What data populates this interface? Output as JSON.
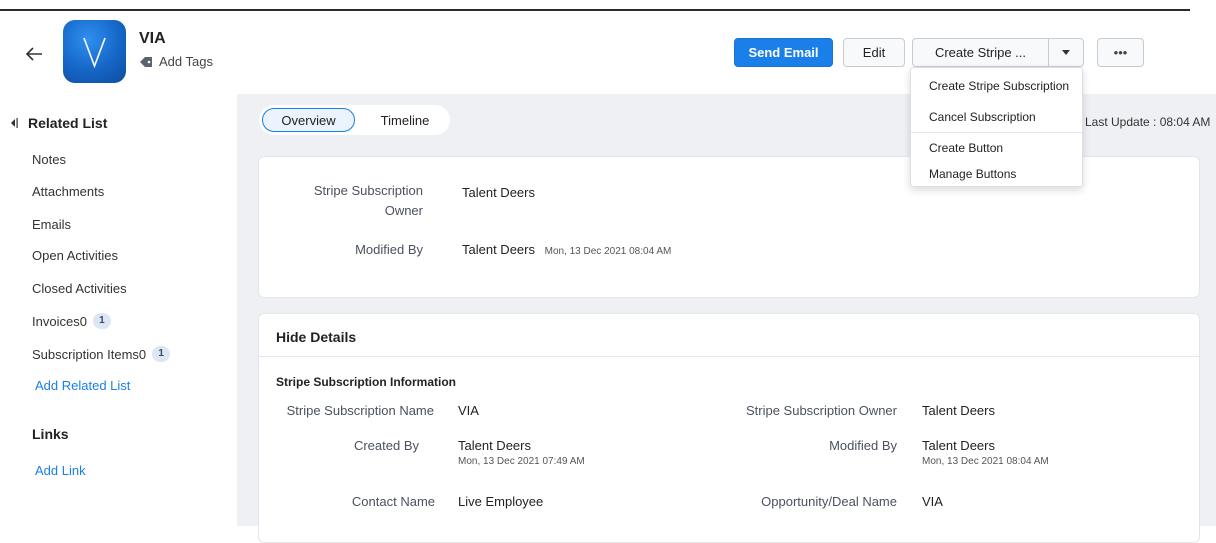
{
  "header": {
    "record_name": "VIA",
    "add_tags_label": "Add Tags",
    "send_email_label": "Send Email",
    "edit_label": "Edit",
    "create_stripe_label": "Create Stripe ...",
    "more_label": "•••"
  },
  "dropdown": {
    "items": [
      "Create Stripe Subscription",
      "Cancel Subscription",
      "Create Button",
      "Manage Buttons"
    ]
  },
  "sidebar": {
    "title": "Related List",
    "items": [
      {
        "label": "Notes"
      },
      {
        "label": "Attachments"
      },
      {
        "label": "Emails"
      },
      {
        "label": "Open Activities"
      },
      {
        "label": "Closed Activities"
      },
      {
        "label": "Invoices0",
        "count": "1"
      },
      {
        "label": "Subscription Items0",
        "count": "1"
      }
    ],
    "add_related_list": "Add Related List",
    "links_title": "Links",
    "add_link": "Add Link"
  },
  "tabs": {
    "overview": "Overview",
    "timeline": "Timeline"
  },
  "last_update": "Last Update : 08:04 AM",
  "overview_card": {
    "owner_label_1": "Stripe Subscription",
    "owner_label_2": "Owner",
    "owner_value": "Talent Deers",
    "modified_label": "Modified By",
    "modified_value": "Talent Deers",
    "modified_time": "Mon, 13 Dec 2021 08:04 AM"
  },
  "details": {
    "hide_details": "Hide Details",
    "section_title": "Stripe Subscription Information",
    "name_label": "Stripe Subscription Name",
    "name_value": "VIA",
    "owner_label": "Stripe Subscription Owner",
    "owner_value": "Talent Deers",
    "created_label": "Created By",
    "created_value": "Talent Deers",
    "created_time": "Mon, 13 Dec 2021 07:49 AM",
    "modified_label": "Modified By",
    "modified_value": "Talent Deers",
    "modified_time": "Mon, 13 Dec 2021 08:04 AM",
    "contact_label": "Contact Name",
    "contact_value": "Live Employee",
    "deal_label": "Opportunity/Deal Name",
    "deal_value": "VIA"
  },
  "colors": {
    "accent": "#1a7fe8",
    "background": "#eef0f4"
  }
}
